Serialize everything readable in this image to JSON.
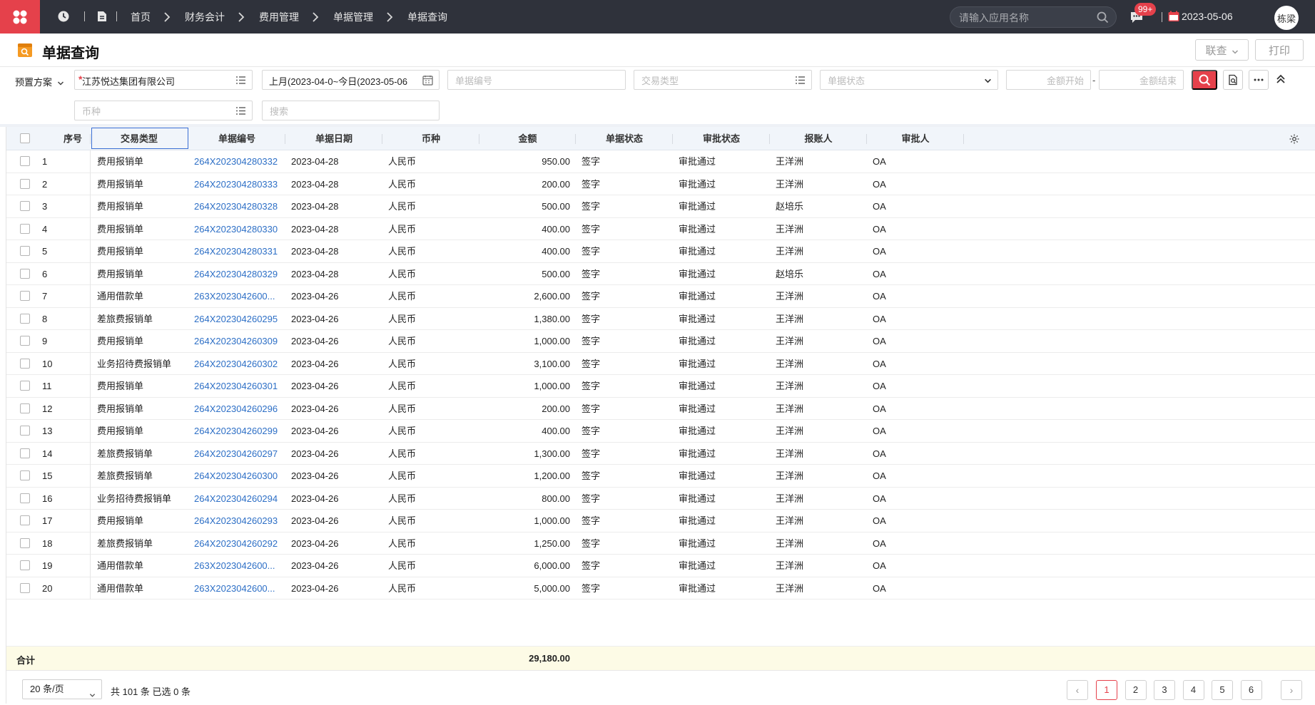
{
  "topbar": {
    "breadcrumbs": [
      "首页",
      "财务会计",
      "费用管理",
      "单据管理",
      "单据查询"
    ],
    "search_placeholder": "请输入应用名称",
    "msg_badge": "99+",
    "date": "2023-05-06",
    "user": "栋梁"
  },
  "page": {
    "title": "单据查询",
    "buttons": {
      "linked_query": "联查",
      "print": "打印"
    }
  },
  "filters": {
    "plan_label": "预置方案",
    "org_value": "江苏悦达集团有限公司",
    "date_value": "上月(2023-04-0~今日(2023-05-06",
    "doc_no_placeholder": "单据编号",
    "trade_type_placeholder": "交易类型",
    "doc_status_placeholder": "单据状态",
    "amount_start_placeholder": "金额开始",
    "amount_end_placeholder": "金额结束",
    "currency_placeholder": "币种",
    "search_placeholder": "搜索"
  },
  "table": {
    "columns": [
      "序号",
      "交易类型",
      "单据编号",
      "单据日期",
      "币种",
      "金额",
      "单据状态",
      "审批状态",
      "报账人",
      "审批人"
    ],
    "rows": [
      [
        "1",
        "费用报销单",
        "264X202304280332",
        "2023-04-28",
        "人民币",
        "950.00",
        "签字",
        "审批通过",
        "王洋洲",
        "OA"
      ],
      [
        "2",
        "费用报销单",
        "264X202304280333",
        "2023-04-28",
        "人民币",
        "200.00",
        "签字",
        "审批通过",
        "王洋洲",
        "OA"
      ],
      [
        "3",
        "费用报销单",
        "264X202304280328",
        "2023-04-28",
        "人民币",
        "500.00",
        "签字",
        "审批通过",
        "赵培乐",
        "OA"
      ],
      [
        "4",
        "费用报销单",
        "264X202304280330",
        "2023-04-28",
        "人民币",
        "400.00",
        "签字",
        "审批通过",
        "王洋洲",
        "OA"
      ],
      [
        "5",
        "费用报销单",
        "264X202304280331",
        "2023-04-28",
        "人民币",
        "400.00",
        "签字",
        "审批通过",
        "王洋洲",
        "OA"
      ],
      [
        "6",
        "费用报销单",
        "264X202304280329",
        "2023-04-28",
        "人民币",
        "500.00",
        "签字",
        "审批通过",
        "赵培乐",
        "OA"
      ],
      [
        "7",
        "通用借款单",
        "263X2023042600...",
        "2023-04-26",
        "人民币",
        "2,600.00",
        "签字",
        "审批通过",
        "王洋洲",
        "OA"
      ],
      [
        "8",
        "差旅费报销单",
        "264X202304260295",
        "2023-04-26",
        "人民币",
        "1,380.00",
        "签字",
        "审批通过",
        "王洋洲",
        "OA"
      ],
      [
        "9",
        "费用报销单",
        "264X202304260309",
        "2023-04-26",
        "人民币",
        "1,000.00",
        "签字",
        "审批通过",
        "王洋洲",
        "OA"
      ],
      [
        "10",
        "业务招待费报销单",
        "264X202304260302",
        "2023-04-26",
        "人民币",
        "3,100.00",
        "签字",
        "审批通过",
        "王洋洲",
        "OA"
      ],
      [
        "11",
        "费用报销单",
        "264X202304260301",
        "2023-04-26",
        "人民币",
        "1,000.00",
        "签字",
        "审批通过",
        "王洋洲",
        "OA"
      ],
      [
        "12",
        "费用报销单",
        "264X202304260296",
        "2023-04-26",
        "人民币",
        "200.00",
        "签字",
        "审批通过",
        "王洋洲",
        "OA"
      ],
      [
        "13",
        "费用报销单",
        "264X202304260299",
        "2023-04-26",
        "人民币",
        "400.00",
        "签字",
        "审批通过",
        "王洋洲",
        "OA"
      ],
      [
        "14",
        "差旅费报销单",
        "264X202304260297",
        "2023-04-26",
        "人民币",
        "1,300.00",
        "签字",
        "审批通过",
        "王洋洲",
        "OA"
      ],
      [
        "15",
        "差旅费报销单",
        "264X202304260300",
        "2023-04-26",
        "人民币",
        "1,200.00",
        "签字",
        "审批通过",
        "王洋洲",
        "OA"
      ],
      [
        "16",
        "业务招待费报销单",
        "264X202304260294",
        "2023-04-26",
        "人民币",
        "800.00",
        "签字",
        "审批通过",
        "王洋洲",
        "OA"
      ],
      [
        "17",
        "费用报销单",
        "264X202304260293",
        "2023-04-26",
        "人民币",
        "1,000.00",
        "签字",
        "审批通过",
        "王洋洲",
        "OA"
      ],
      [
        "18",
        "差旅费报销单",
        "264X202304260292",
        "2023-04-26",
        "人民币",
        "1,250.00",
        "签字",
        "审批通过",
        "王洋洲",
        "OA"
      ],
      [
        "19",
        "通用借款单",
        "263X2023042600...",
        "2023-04-26",
        "人民币",
        "6,000.00",
        "签字",
        "审批通过",
        "王洋洲",
        "OA"
      ],
      [
        "20",
        "通用借款单",
        "263X2023042600...",
        "2023-04-26",
        "人民币",
        "5,000.00",
        "签字",
        "审批通过",
        "王洋洲",
        "OA"
      ]
    ],
    "summary_label": "合计",
    "summary_value": "29,180.00"
  },
  "pager": {
    "page_size": "20 条/页",
    "total_text": "共 101 条 已选 0 条",
    "prev": "‹",
    "next": "›",
    "pages": [
      "1",
      "2",
      "3",
      "4",
      "5",
      "6"
    ],
    "current": "1"
  },
  "colors": {
    "accent": "#e5414b",
    "link": "#2d6fc6",
    "topbar": "#2f323b"
  },
  "icons": [
    "logo-icon",
    "clock-icon",
    "document-icon",
    "chevron-right-icon",
    "search-icon",
    "message-icon",
    "calendar-icon",
    "list-icon",
    "chevron-down-icon",
    "more-icon",
    "collapse-icon",
    "gear-icon",
    "checkbox-icon"
  ]
}
